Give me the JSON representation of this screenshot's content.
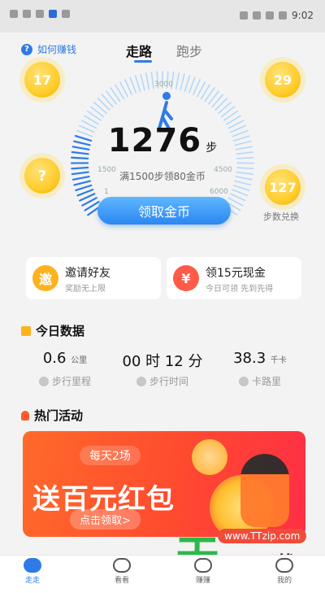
{
  "status_bar": {
    "time": "9:02"
  },
  "top": {
    "help": "如何赚钱",
    "tabs": [
      {
        "label": "走路",
        "active": true
      },
      {
        "label": "跑步",
        "active": false
      }
    ]
  },
  "coins": {
    "left_top": "17",
    "left_mid": "?",
    "right_top": "29",
    "right_bottom": "127",
    "right_bottom_label": "步数兑换"
  },
  "gauge": {
    "ticks": [
      "1",
      "1500",
      "3000",
      "4500",
      "6000"
    ],
    "steps": "1276",
    "steps_unit": "步",
    "goal_text": "满1500步领80金币",
    "button": "领取金币",
    "progress_fraction": 0.21
  },
  "cards": [
    {
      "icon": "invite-icon",
      "badge": "邀",
      "title": "邀请好友",
      "subtitle": "奖励无上限"
    },
    {
      "icon": "red-envelope-icon",
      "badge": "¥",
      "title": "领15元现金",
      "subtitle": "今日可领 先到先得"
    }
  ],
  "today": {
    "title": "今日数据",
    "metrics": [
      {
        "value": "0.6",
        "unit": "公里",
        "label": "步行里程"
      },
      {
        "value": "00 时 12 分",
        "unit": "",
        "label": "步行时间"
      },
      {
        "value": "38.3",
        "unit": "千卡",
        "label": "卡路里"
      }
    ]
  },
  "activity": {
    "title": "热门活动",
    "banner": {
      "pill": "每天2场",
      "headline": "送百元红包",
      "cta": "点击领取>"
    }
  },
  "watermark": {
    "logo": "天",
    "text": "天下载",
    "url": "www.TTzip.com"
  },
  "bottom_nav": [
    {
      "label": "走走",
      "icon": "shoe-icon",
      "active": true
    },
    {
      "label": "看看",
      "icon": "eye-icon",
      "active": false
    },
    {
      "label": "赚赚",
      "icon": "money-icon",
      "active": false
    },
    {
      "label": "我的",
      "icon": "user-icon",
      "active": false
    }
  ],
  "colors": {
    "accent": "#2f7be5",
    "coin": "#ffcd2b",
    "banner": "#ff4a2f",
    "watermark_green": "#2db84a"
  }
}
